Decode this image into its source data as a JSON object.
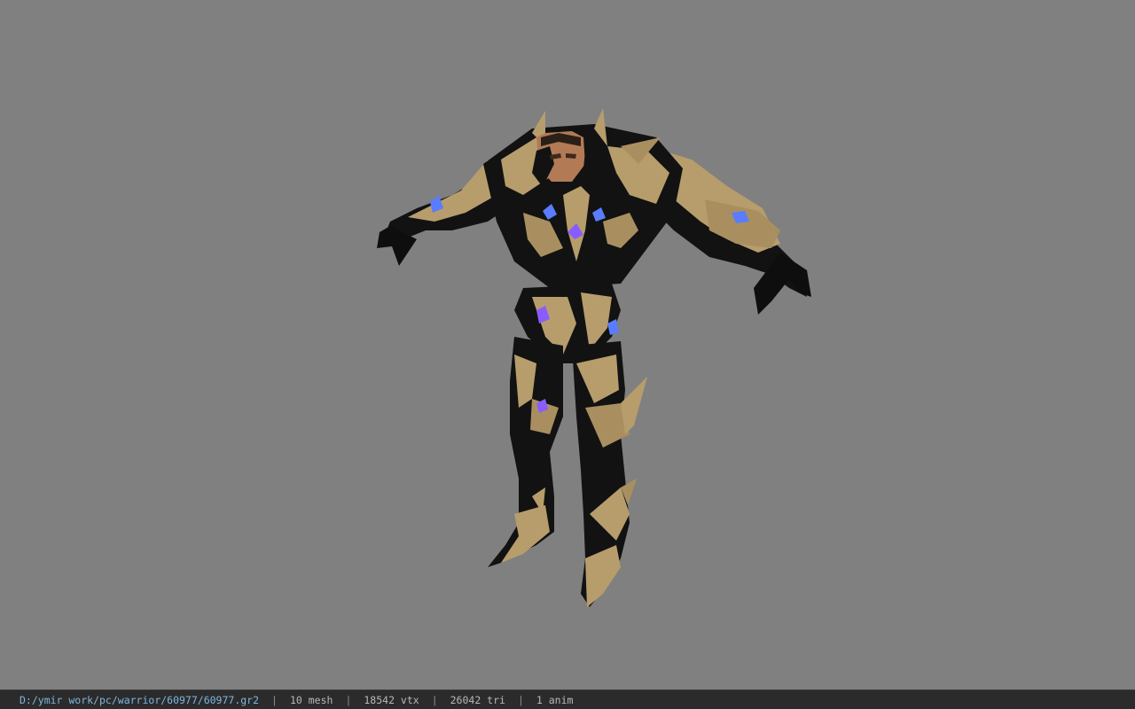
{
  "viewer": {
    "background_color": "#808080",
    "model_preview": {
      "icon": "armored-warrior-model",
      "colors": {
        "armor_gold": "#b79d6c",
        "armor_dark": "#121212",
        "gem_blue": "#5a7cff",
        "gem_purple": "#8a5cff",
        "skin": "#b27b55"
      }
    }
  },
  "status_bar": {
    "file_path": "D:/ymir work/pc/warrior/60977/60977.gr2",
    "separator": "|",
    "mesh_count": "10 mesh",
    "vertex_count": "18542 vtx",
    "triangle_count": "26042 tri",
    "animation_count": "1 anim"
  }
}
